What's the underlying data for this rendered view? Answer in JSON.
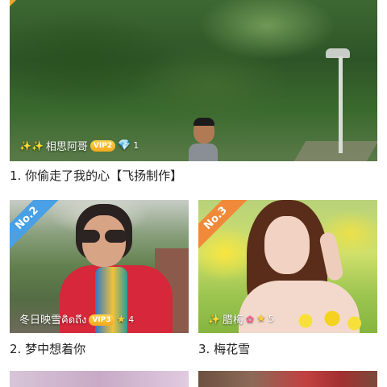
{
  "items": [
    {
      "title": "1. 你偷走了我的心【飞扬制作】",
      "user": {
        "prefix": "✨✨",
        "name": "相思阿哥",
        "vip": "VIP2",
        "badge_icon": "diamond-icon",
        "count": "1"
      }
    },
    {
      "rank": "No.2",
      "title": "2. 梦中想着你",
      "user": {
        "name": "冬日映雪คิดถึง",
        "vip": "VIP3",
        "badge_icon": "star-icon",
        "count": "4"
      }
    },
    {
      "rank": "No.3",
      "title": "3. 梅花雪",
      "user": {
        "prefix": "✨",
        "name": "腊梅",
        "suffix_icon": "flower-icon",
        "badge_icon": "star-icon",
        "count": "5"
      }
    }
  ],
  "colors": {
    "rank2": "#4aa0e4",
    "rank3": "#f08a3a",
    "vip": "#f4a91f"
  }
}
